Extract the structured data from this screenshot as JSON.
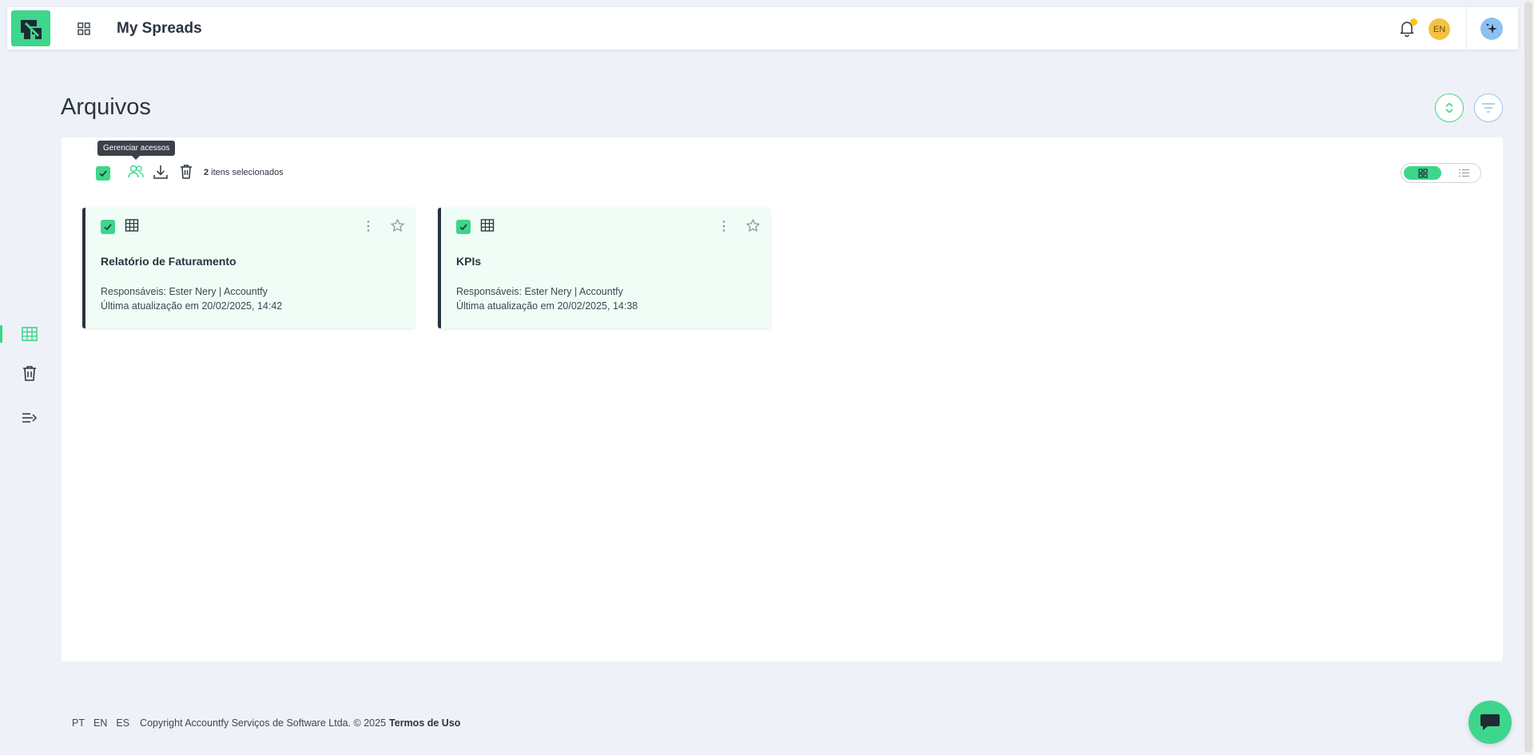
{
  "app": {
    "title": "My Spreads",
    "user_lang": "EN"
  },
  "page": {
    "title": "Arquivos"
  },
  "toolbar": {
    "tooltip": "Gerenciar acessos",
    "selected_count": "2",
    "selected_label": " itens selecionados"
  },
  "files": [
    {
      "title": "Relatório de Faturamento",
      "owners": "Responsáveis: Ester Nery | Accountfy",
      "updated": "Última atualização em 20/02/2025, 14:42"
    },
    {
      "title": "KPIs",
      "owners": "Responsáveis: Ester Nery | Accountfy",
      "updated": "Última atualização em 20/02/2025, 14:38"
    }
  ],
  "footer": {
    "langs": [
      "PT",
      "EN",
      "ES"
    ],
    "copyright": "Copyright Accountfy Serviços de Software Ltda. © 2025",
    "terms": "Termos de Uso"
  },
  "colors": {
    "accent": "#3dd68c",
    "background": "#eef1f8",
    "card_bg": "#f0fdf6",
    "dark": "#263340"
  }
}
